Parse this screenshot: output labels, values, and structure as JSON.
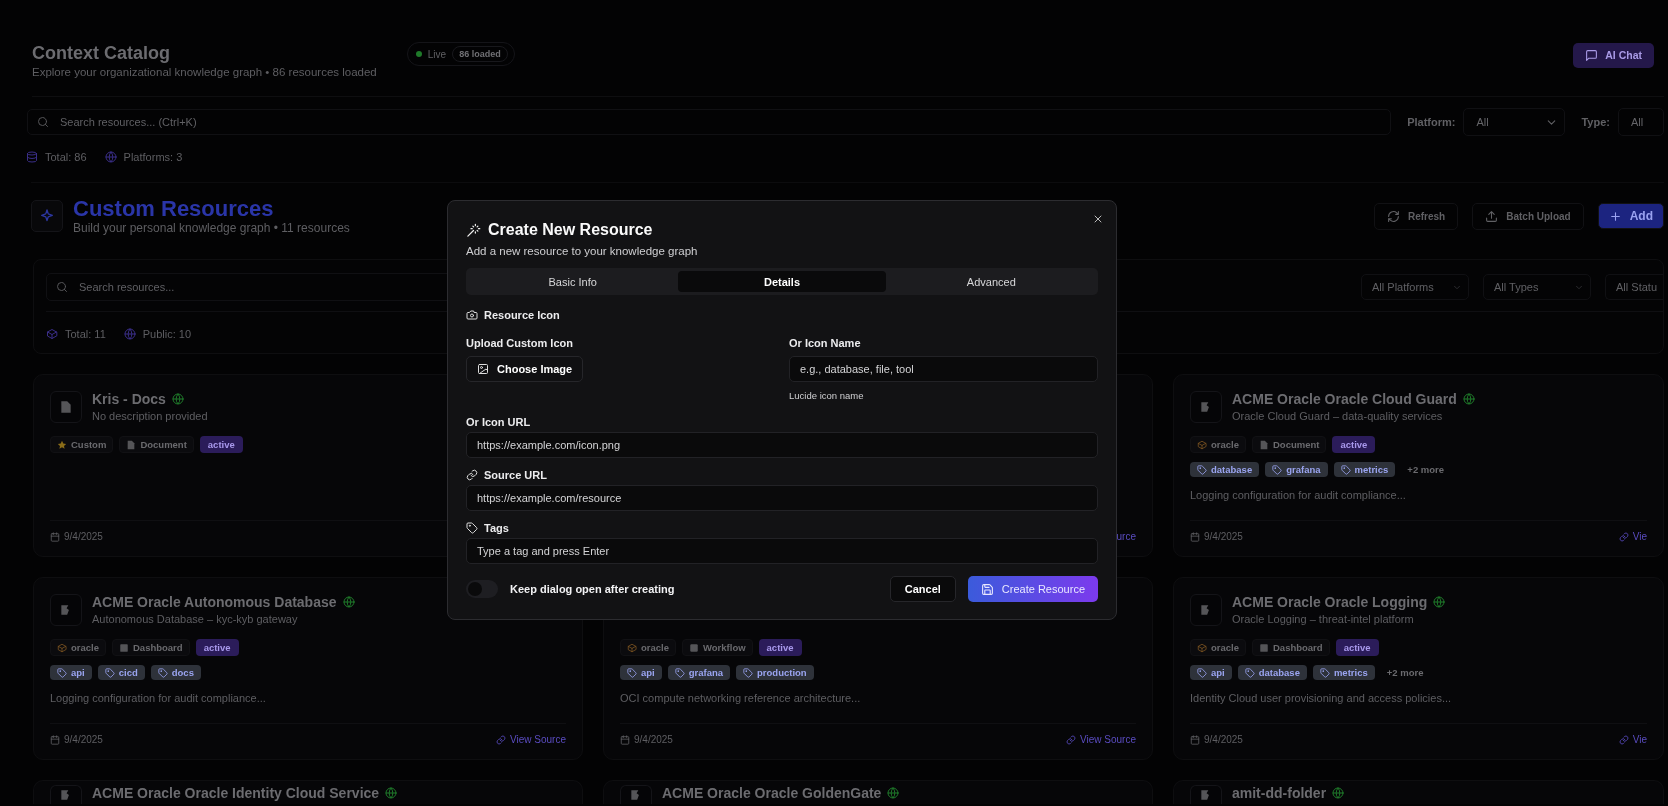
{
  "header": {
    "title": "Context Catalog",
    "subtitle": "Explore your organizational knowledge graph • 86 resources loaded",
    "live": {
      "label": "Live",
      "count": "86 loaded"
    },
    "ai_chat_button": "AI Chat"
  },
  "catalog_search": {
    "placeholder": "Search resources... (Ctrl+K)"
  },
  "filters": [
    {
      "label": "Platform:",
      "value": "All"
    },
    {
      "label": "Type:",
      "value": "All"
    }
  ],
  "catalog_stats": [
    {
      "kind": "database",
      "text": "Total: 86"
    },
    {
      "kind": "globe",
      "text": "Platforms: 3"
    }
  ],
  "custom": {
    "title": "Custom Resources",
    "subtitle": "Build your personal knowledge graph • 11 resources",
    "buttons": [
      {
        "kind": "refresh",
        "label": "Refresh"
      },
      {
        "kind": "upload",
        "label": "Batch Upload"
      },
      {
        "kind": "add",
        "label": "Add"
      }
    ],
    "search": {
      "placeholder": "Search resources..."
    },
    "selects": [
      "All Platforms",
      "All Types",
      "All Statu"
    ],
    "stats": [
      {
        "kind": "package",
        "text": "Total: 11"
      },
      {
        "kind": "globe",
        "text": "Public: 10"
      }
    ]
  },
  "cards": [
    {
      "kind": "document",
      "title": "Kris - Docs",
      "public": true,
      "description": "No description provided",
      "badges": [
        {
          "kind": "star",
          "label": "Custom"
        },
        {
          "kind": "file",
          "label": "Document"
        },
        {
          "kind": "status",
          "label": "active"
        }
      ],
      "date": "9/4/2025"
    },
    {
      "link": "urce"
    },
    {
      "kind": "resource",
      "title": "ACME Oracle Oracle Cloud Guard",
      "public": true,
      "description": "Oracle Cloud Guard – data-quality services",
      "badges": [
        {
          "kind": "package",
          "label": "oracle"
        },
        {
          "kind": "file",
          "label": "Document"
        },
        {
          "kind": "status",
          "label": "active"
        }
      ],
      "tags": [
        "database",
        "grafana",
        "metrics"
      ],
      "more": "+2 more",
      "summary": "Logging configuration for audit compliance...",
      "date": "9/4/2025",
      "link": "Vie"
    },
    {
      "kind": "resource",
      "title": "ACME Oracle Autonomous Database",
      "public": true,
      "description": "Autonomous Database – kyc-kyb gateway",
      "badges": [
        {
          "kind": "package",
          "label": "oracle"
        },
        {
          "kind": "dashboard",
          "label": "Dashboard"
        },
        {
          "kind": "status",
          "label": "active"
        }
      ],
      "tags": [
        "api",
        "cicd",
        "docs"
      ],
      "summary": "Logging configuration for audit compliance...",
      "date": "9/4/2025",
      "link": "View Source"
    },
    {
      "badges": [
        {
          "kind": "package",
          "label": "oracle"
        },
        {
          "kind": "workflow",
          "label": "Workflow"
        },
        {
          "kind": "status",
          "label": "active"
        }
      ],
      "tags": [
        "api",
        "grafana",
        "production"
      ],
      "summary": "OCI compute networking reference architecture...",
      "date": "9/4/2025",
      "link": "View Source"
    },
    {
      "kind": "resource",
      "title": "ACME Oracle Oracle Logging",
      "public": true,
      "description": "Oracle Logging – threat-intel platform",
      "badges": [
        {
          "kind": "package",
          "label": "oracle"
        },
        {
          "kind": "dashboard",
          "label": "Dashboard"
        },
        {
          "kind": "status",
          "label": "active"
        }
      ],
      "tags": [
        "api",
        "database",
        "metrics"
      ],
      "more": "+2 more",
      "summary": "Identity Cloud user provisioning and access policies...",
      "date": "9/4/2025",
      "link": "Vie"
    },
    {
      "kind": "resource",
      "title": "ACME Oracle Oracle Identity Cloud Service",
      "public": true
    },
    {
      "kind": "resource",
      "title": "ACME Oracle Oracle GoldenGate",
      "public": true
    },
    {
      "kind": "resource",
      "title": "amit-dd-folder",
      "public": true
    }
  ],
  "dialog": {
    "title": "Create New Resource",
    "subtitle": "Add a new resource to your knowledge graph",
    "tabs": [
      {
        "label": "Basic Info",
        "selected": false
      },
      {
        "label": "Details",
        "selected": true
      },
      {
        "label": "Advanced",
        "selected": false
      }
    ],
    "section": "Resource Icon",
    "upload_label": "Upload Custom Icon",
    "choose_button": "Choose Image",
    "icon_name": {
      "label": "Or Icon Name",
      "placeholder": "e.g., database, file, tool",
      "hint": "Lucide icon name"
    },
    "fields": [
      {
        "kind": "plain",
        "label": "Or Icon URL",
        "placeholder": "https://example.com/icon.png"
      },
      {
        "kind": "link",
        "label": "Source URL",
        "placeholder": "https://example.com/resource"
      },
      {
        "kind": "tag",
        "label": "Tags",
        "placeholder": "Type a tag and press Enter"
      }
    ],
    "keep_open": {
      "label": "Keep dialog open after creating",
      "on": false
    },
    "cancel_button": "Cancel",
    "create_button": "Create Resource"
  }
}
